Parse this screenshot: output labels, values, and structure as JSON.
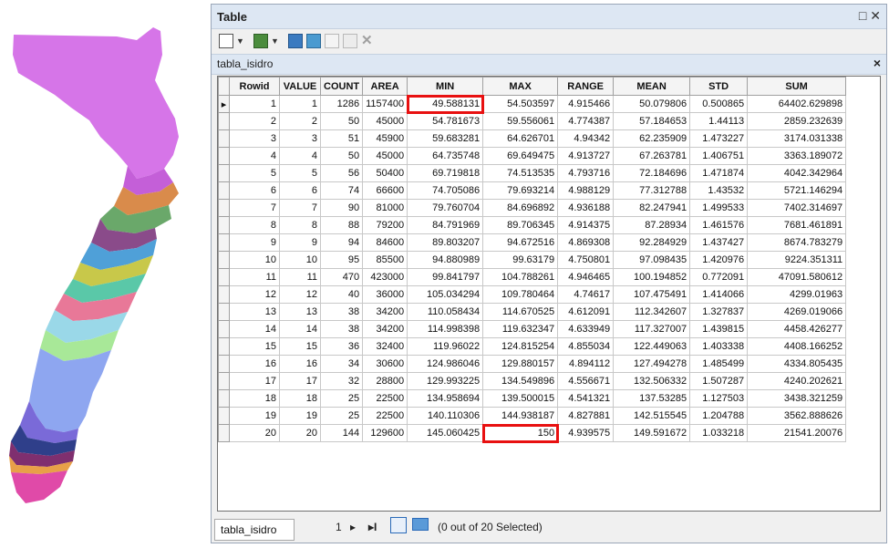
{
  "window": {
    "title": "Table"
  },
  "tab": {
    "name": "tabla_isidro",
    "bottom_tab": "tabla_isidro"
  },
  "columns": [
    "Rowid",
    "VALUE",
    "COUNT",
    "AREA",
    "MIN",
    "MAX",
    "RANGE",
    "MEAN",
    "STD",
    "SUM"
  ],
  "rows": [
    [
      "1",
      "1",
      "1286",
      "1157400",
      "49.588131",
      "54.503597",
      "4.915466",
      "50.079806",
      "0.500865",
      "64402.629898"
    ],
    [
      "2",
      "2",
      "50",
      "45000",
      "54.781673",
      "59.556061",
      "4.774387",
      "57.184653",
      "1.44113",
      "2859.232639"
    ],
    [
      "3",
      "3",
      "51",
      "45900",
      "59.683281",
      "64.626701",
      "4.94342",
      "62.235909",
      "1.473227",
      "3174.031338"
    ],
    [
      "4",
      "4",
      "50",
      "45000",
      "64.735748",
      "69.649475",
      "4.913727",
      "67.263781",
      "1.406751",
      "3363.189072"
    ],
    [
      "5",
      "5",
      "56",
      "50400",
      "69.719818",
      "74.513535",
      "4.793716",
      "72.184696",
      "1.471874",
      "4042.342964"
    ],
    [
      "6",
      "6",
      "74",
      "66600",
      "74.705086",
      "79.693214",
      "4.988129",
      "77.312788",
      "1.43532",
      "5721.146294"
    ],
    [
      "7",
      "7",
      "90",
      "81000",
      "79.760704",
      "84.696892",
      "4.936188",
      "82.247941",
      "1.499533",
      "7402.314697"
    ],
    [
      "8",
      "8",
      "88",
      "79200",
      "84.791969",
      "89.706345",
      "4.914375",
      "87.28934",
      "1.461576",
      "7681.461891"
    ],
    [
      "9",
      "9",
      "94",
      "84600",
      "89.803207",
      "94.672516",
      "4.869308",
      "92.284929",
      "1.437427",
      "8674.783279"
    ],
    [
      "10",
      "10",
      "95",
      "85500",
      "94.880989",
      "99.63179",
      "4.750801",
      "97.098435",
      "1.420976",
      "9224.351311"
    ],
    [
      "11",
      "11",
      "470",
      "423000",
      "99.841797",
      "104.788261",
      "4.946465",
      "100.194852",
      "0.772091",
      "47091.580612"
    ],
    [
      "12",
      "12",
      "40",
      "36000",
      "105.034294",
      "109.780464",
      "4.74617",
      "107.475491",
      "1.414066",
      "4299.01963"
    ],
    [
      "13",
      "13",
      "38",
      "34200",
      "110.058434",
      "114.670525",
      "4.612091",
      "112.342607",
      "1.327837",
      "4269.019066"
    ],
    [
      "14",
      "14",
      "38",
      "34200",
      "114.998398",
      "119.632347",
      "4.633949",
      "117.327007",
      "1.439815",
      "4458.426277"
    ],
    [
      "15",
      "15",
      "36",
      "32400",
      "119.96022",
      "124.815254",
      "4.855034",
      "122.449063",
      "1.403338",
      "4408.166252"
    ],
    [
      "16",
      "16",
      "34",
      "30600",
      "124.986046",
      "129.880157",
      "4.894112",
      "127.494278",
      "1.485499",
      "4334.805435"
    ],
    [
      "17",
      "17",
      "32",
      "28800",
      "129.993225",
      "134.549896",
      "4.556671",
      "132.506332",
      "1.507287",
      "4240.202621"
    ],
    [
      "18",
      "18",
      "25",
      "22500",
      "134.958694",
      "139.500015",
      "4.541321",
      "137.53285",
      "1.127503",
      "3438.321259"
    ],
    [
      "19",
      "19",
      "25",
      "22500",
      "140.110306",
      "144.938187",
      "4.827881",
      "142.515545",
      "1.204788",
      "3562.888626"
    ],
    [
      "20",
      "20",
      "144",
      "129600",
      "145.060425",
      "150",
      "4.939575",
      "149.591672",
      "1.033218",
      "21541.20076"
    ]
  ],
  "navigation": {
    "record": "1",
    "status": "(0 out of 20 Selected)"
  },
  "colors": {
    "highlight": "#e81010",
    "titlebar": "#dde7f3"
  }
}
